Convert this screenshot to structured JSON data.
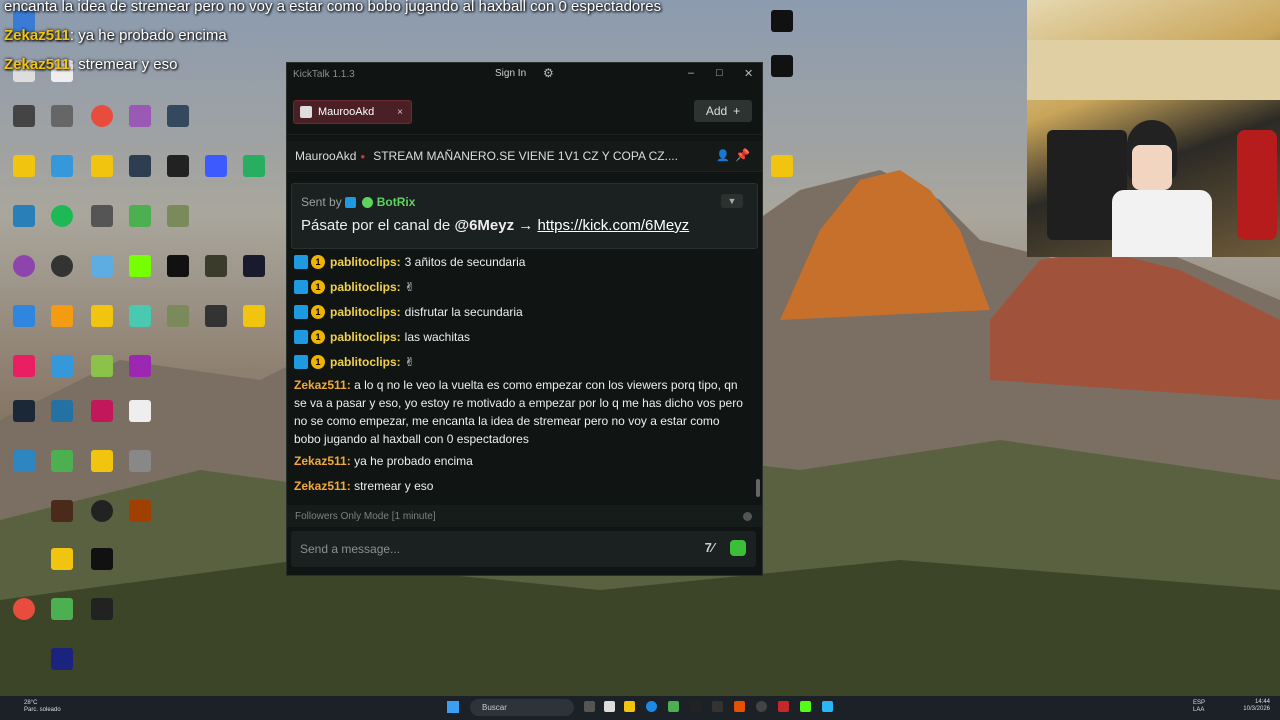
{
  "overlay": {
    "line1": "encanta la idea de stremear pero no voy a estar como bobo jugando al haxball con 0 espectadores",
    "line2_user": "Zekaz511",
    "line2_text": ": ya he probado encima",
    "line3_user": "Zekaz511",
    "line3_text": ": stremear y eso"
  },
  "window": {
    "app_title": "KickTalk 1.1.3",
    "sign_in": "Sign In",
    "minimize": "–",
    "maximize": "□",
    "close": "✕"
  },
  "tabs": [
    {
      "label": "MaurooAkd",
      "close": "×"
    }
  ],
  "add_button": "Add",
  "add_plus": "+",
  "channel": {
    "name": "MaurooAkd",
    "live_dot": "●",
    "stream_title": "STREAM MAÑANERO.SE VIENE 1V1 CZ Y COPA CZ...."
  },
  "pinned": {
    "sent_by_prefix": "Sent by",
    "bot_name": "BotRix",
    "message_prefix": "Pásate por el canal de",
    "mention": "@6Meyz",
    "arrow": "→",
    "link": "https://kick.com/6Meyz"
  },
  "messages": [
    {
      "user": "pablitoclips:",
      "text": "3 añitos de secundaria",
      "badge_num": "1"
    },
    {
      "user": "pablitoclips:",
      "text": "✌",
      "badge_num": "1"
    },
    {
      "user": "pablitoclips:",
      "text": "disfrutar la secundaria",
      "badge_num": "1"
    },
    {
      "user": "pablitoclips:",
      "text": "las wachitas",
      "badge_num": "1"
    },
    {
      "user": "pablitoclips:",
      "text": "✌",
      "badge_num": "1"
    }
  ],
  "long_message": {
    "user": "Zekaz511:",
    "text": "a lo q no le veo la vuelta es como empezar con los viewers porq tipo, qn se va a pasar y eso, yo estoy re motivado a empezar por lo q me has dicho vos pero no se como empezar, me encanta la idea de stremear pero no voy a estar como bobo jugando al haxball con 0 espectadores"
  },
  "messages2": [
    {
      "user": "Zekaz511:",
      "text": "ya he probado encima"
    },
    {
      "user": "Zekaz511:",
      "text": "stremear y eso"
    }
  ],
  "followers_mode": "Followers Only Mode [1 minute]",
  "input_placeholder": "Send a message...",
  "taskbar": {
    "weather_temp": "28°C",
    "weather_desc": "Parc. soleado",
    "search": "Buscar",
    "lang1": "ESP",
    "lang2": "LAA",
    "time": "14:44",
    "date": "10/3/2026"
  },
  "colors": {
    "accent_green": "#53fc18",
    "username_yellow": "#f2d14a",
    "tab_red": "#4a1f25"
  }
}
